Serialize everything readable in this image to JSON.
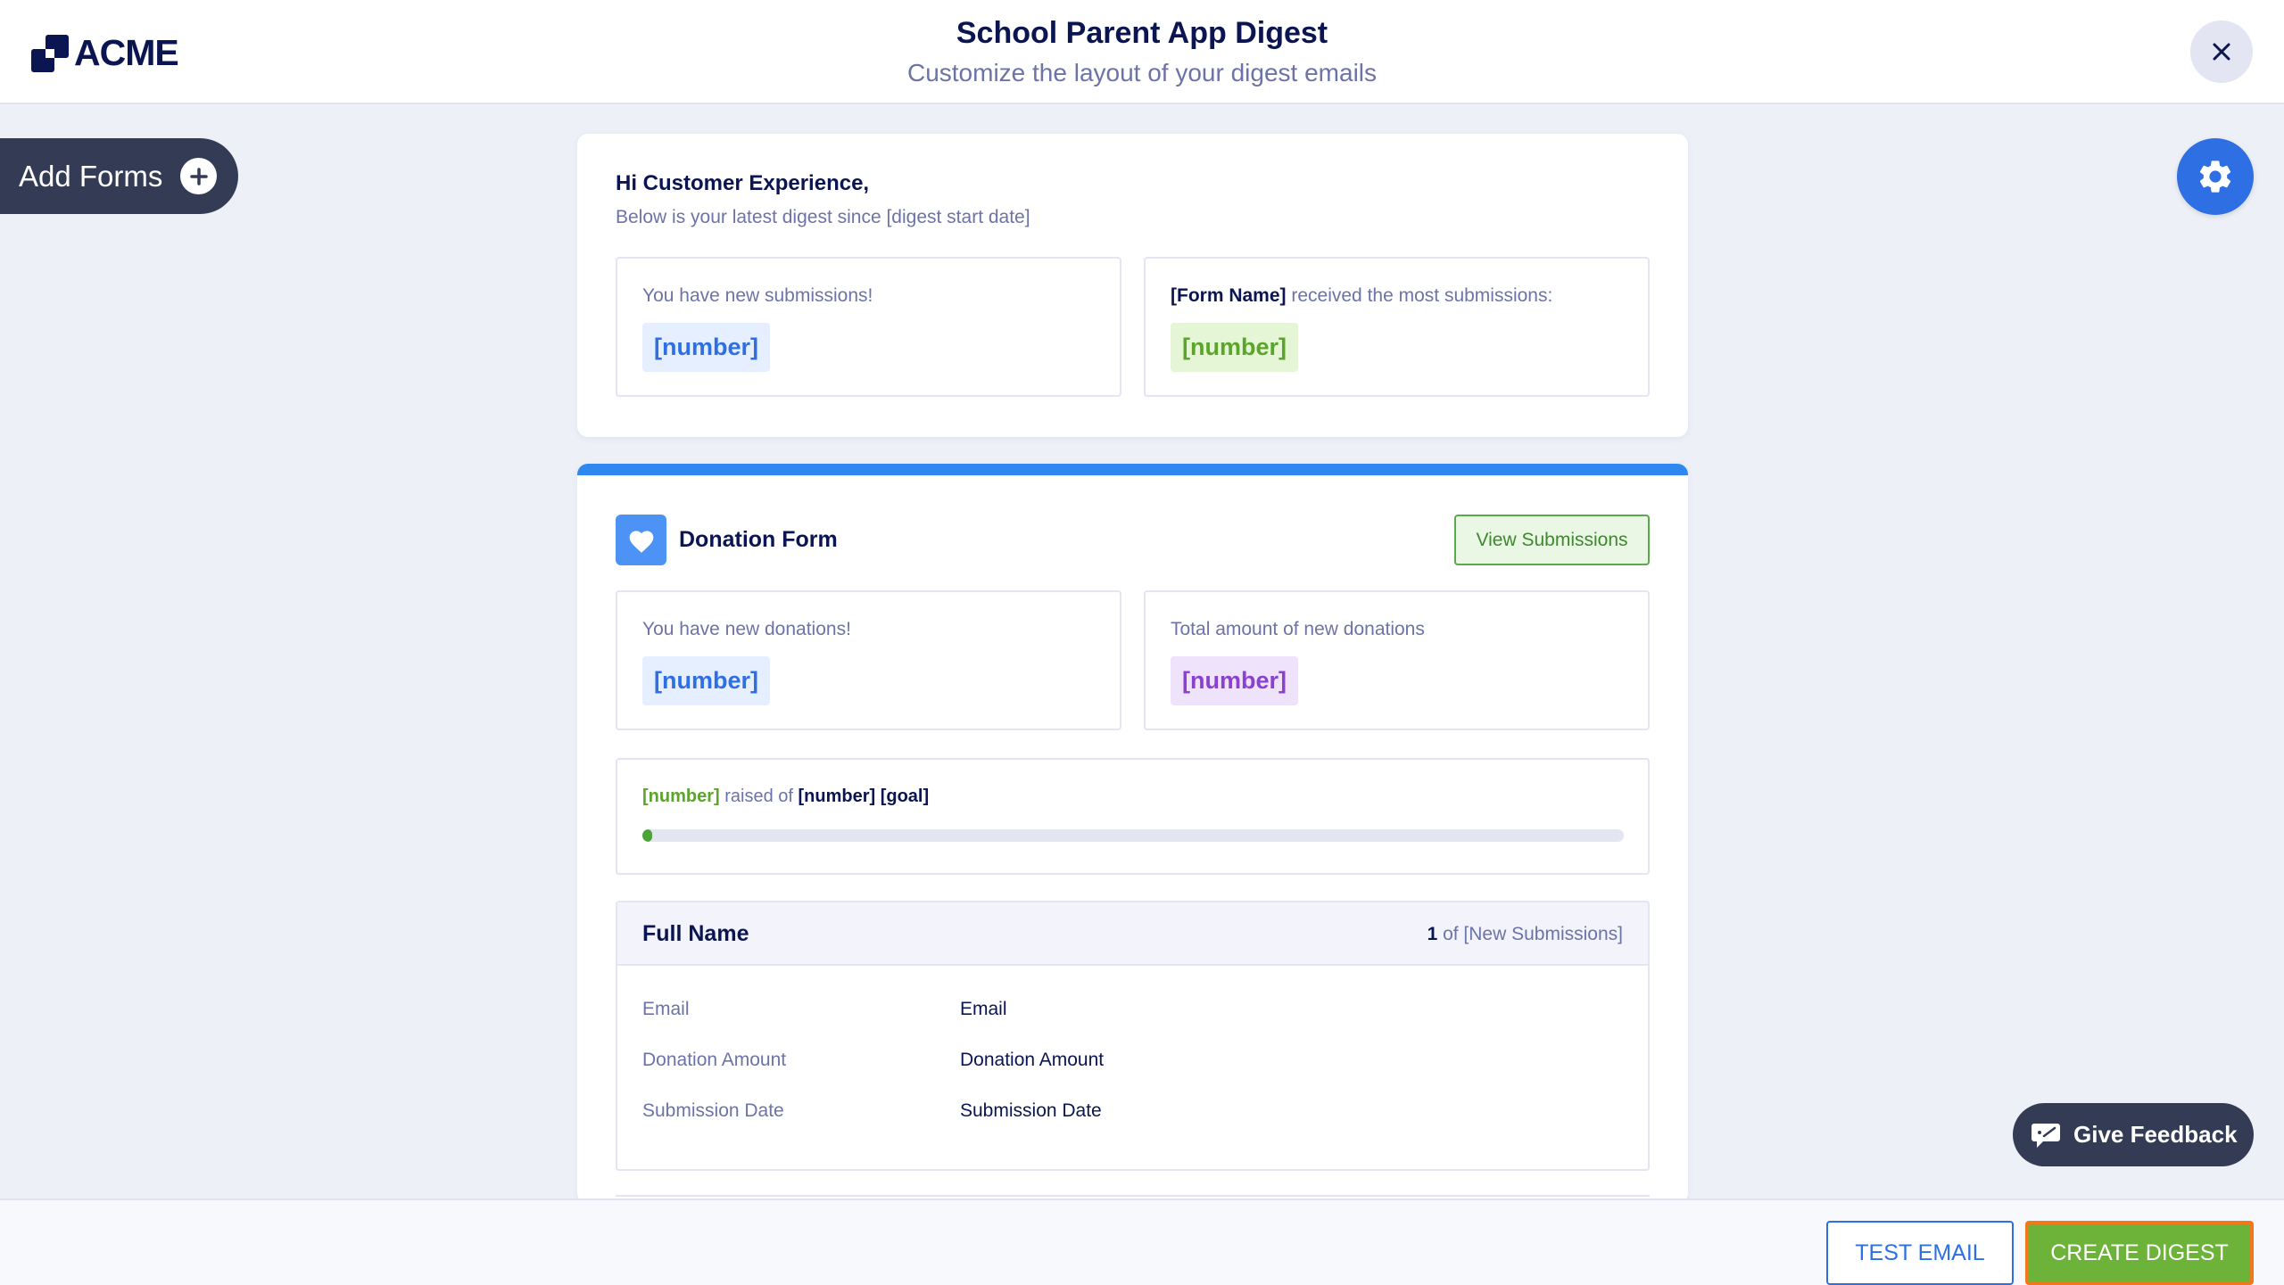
{
  "header": {
    "logo_text": "ACME",
    "title": "School Parent App Digest",
    "subtitle": "Customize the layout of your digest emails"
  },
  "sidebar": {
    "add_forms_label": "Add Forms"
  },
  "greeting": {
    "title": "Hi Customer Experience,",
    "subtitle": "Below is your latest digest since [digest start date]",
    "stats": [
      {
        "label": "You have new submissions!",
        "value": "[number]"
      },
      {
        "label_bold": "[Form Name]",
        "label": " received the most submissions:",
        "value": "[number]"
      }
    ]
  },
  "donation": {
    "form_name": "Donation Form",
    "view_button": "View Submissions",
    "stats": [
      {
        "label": "You have new donations!",
        "value": "[number]"
      },
      {
        "label": "Total amount of new donations",
        "value": "[number]"
      }
    ],
    "goal": {
      "raised": "[number]",
      "raised_of": " raised of ",
      "goal": "[number] [goal]",
      "progress": 0.01
    },
    "submission": {
      "title": "Full Name",
      "count_current": "1",
      "count_suffix": " of [New Submissions]",
      "rows": [
        {
          "label": "Email",
          "value": "Email"
        },
        {
          "label": "Donation Amount",
          "value": "Donation Amount"
        },
        {
          "label": "Submission Date",
          "value": "Submission Date"
        }
      ]
    }
  },
  "feedback": {
    "label": "Give Feedback"
  },
  "footer": {
    "test_email": "TEST EMAIL",
    "create_digest": "CREATE DIGEST"
  },
  "colors": {
    "navy": "#0a1551",
    "blue": "#2f6fe4",
    "green": "#6db33a",
    "highlight_border": "#f07a1a"
  }
}
